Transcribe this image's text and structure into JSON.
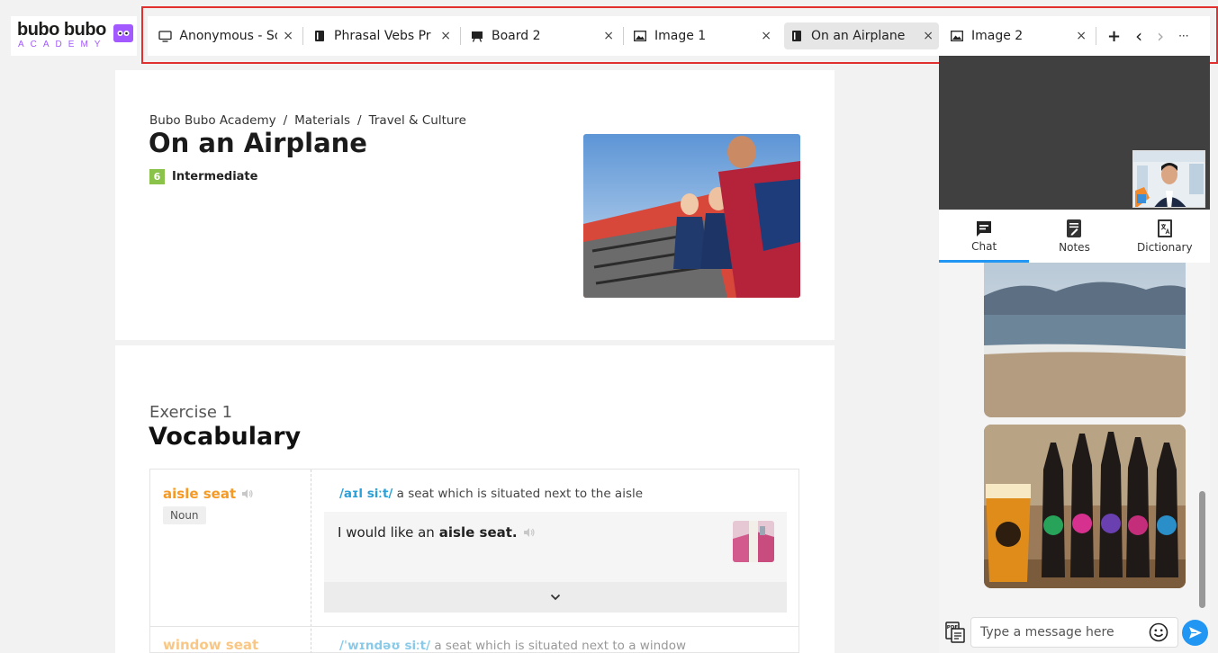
{
  "logo": {
    "word": "bubo bubo",
    "sub": "ACADEMY"
  },
  "tabs": [
    {
      "label": "Anonymous - Sc",
      "icon": "monitor-icon",
      "active": false
    },
    {
      "label": "Phrasal Vebs Pr",
      "icon": "book-icon",
      "active": false
    },
    {
      "label": "Board 2",
      "icon": "whiteboard-icon",
      "active": false
    },
    {
      "label": "Image 1",
      "icon": "image-icon",
      "active": false
    },
    {
      "label": "On an Airplane",
      "icon": "book-icon",
      "active": true
    },
    {
      "label": "Image 2",
      "icon": "image-icon",
      "active": false
    }
  ],
  "tabbar": {
    "close": "×",
    "add": "+",
    "prev": "‹",
    "next": "›",
    "more": "···"
  },
  "lesson": {
    "breadcrumb": [
      "Bubo Bubo Academy",
      "Materials",
      "Travel & Culture"
    ],
    "breadcrumb_sep": "/",
    "title": "On an Airplane",
    "level_number": "6",
    "level_label": "Intermediate"
  },
  "exercise": {
    "label": "Exercise 1",
    "title": "Vocabulary",
    "items": [
      {
        "term": "aisle seat",
        "pos": "Noun",
        "ipa": "/aɪl siːt/",
        "definition": "a seat which is situated next to the aisle",
        "example_before": "I would like an",
        "example_bold": "aisle seat."
      },
      {
        "term": "window seat",
        "ipa": "/ˈwɪndəʊ siːt/",
        "definition": "a seat which is situated next to a window"
      }
    ]
  },
  "side_tabs": [
    {
      "label": "Chat",
      "icon": "chat-icon",
      "active": true
    },
    {
      "label": "Notes",
      "icon": "notes-icon",
      "active": false
    },
    {
      "label": "Dictionary",
      "icon": "dictionary-icon",
      "active": false
    }
  ],
  "chat": {
    "placeholder": "Type a message here"
  },
  "colors": {
    "accent": "#2196f3",
    "term": "#f59a23",
    "level": "#8bc34a",
    "highlight": "#e03030",
    "brand": "#a259ff"
  }
}
